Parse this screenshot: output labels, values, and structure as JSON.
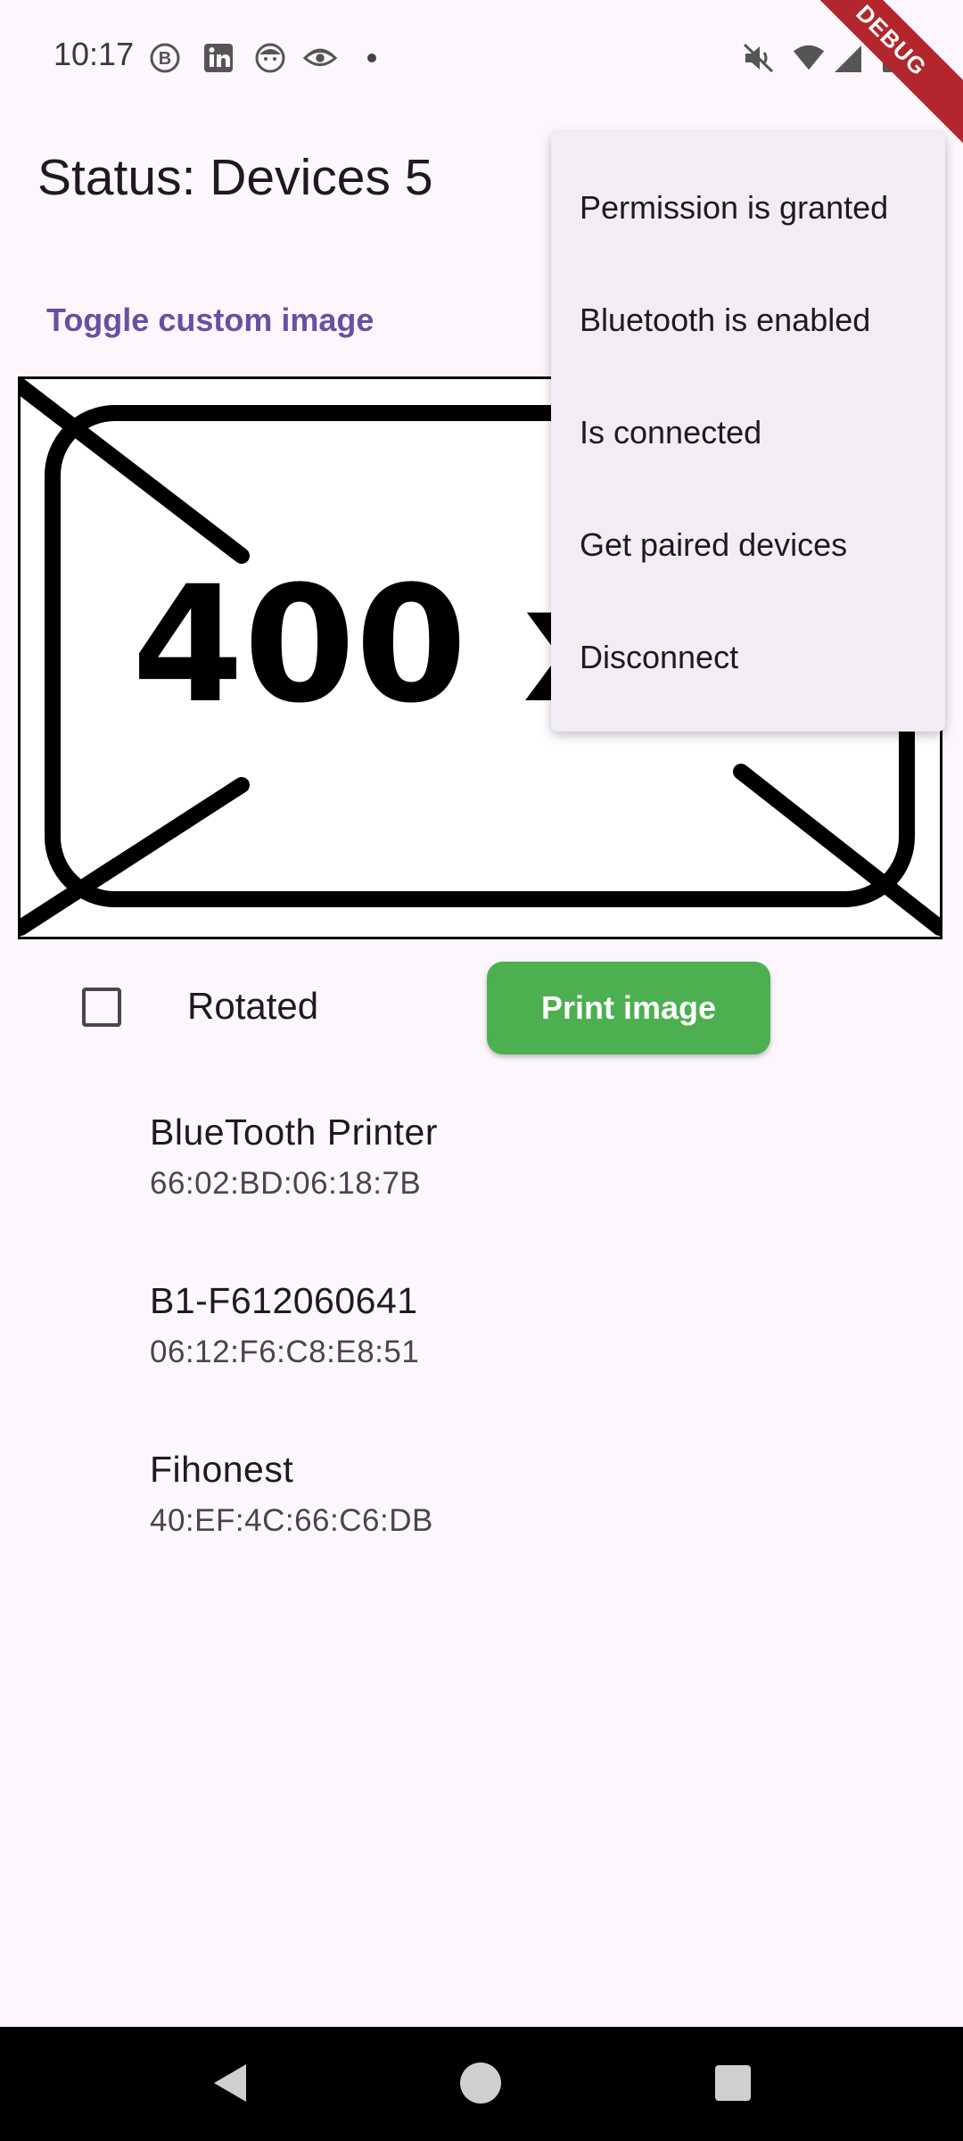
{
  "status_bar": {
    "time": "10:17",
    "left_icons": [
      "b-circle-icon",
      "linkedin-icon",
      "face-icon",
      "eye-icon"
    ],
    "right_icons": [
      "mute-icon",
      "wifi-icon",
      "signal-icon",
      "battery-icon"
    ]
  },
  "debug_banner": "DEBUG",
  "header": {
    "title": "Status: Devices 5"
  },
  "toggle_custom_image_label": "Toggle custom image",
  "preview_image": {
    "text": "400 x"
  },
  "controls": {
    "rotated_label": "Rotated",
    "rotated_checked": false,
    "print_label": "Print image",
    "print_color": "#4caf50"
  },
  "devices": [
    {
      "name": "BlueTooth Printer",
      "address": "66:02:BD:06:18:7B"
    },
    {
      "name": "B1-F612060641",
      "address": "06:12:F6:C8:E8:51"
    },
    {
      "name": "Fihonest",
      "address": "40:EF:4C:66:C6:DB"
    }
  ],
  "menu": {
    "items": [
      {
        "label": "Permission is granted"
      },
      {
        "label": "Bluetooth is enabled"
      },
      {
        "label": "Is connected"
      },
      {
        "label": "Get paired devices"
      },
      {
        "label": "Disconnect"
      }
    ]
  },
  "colors": {
    "accent": "#6750a4",
    "background": "#fdf7fd",
    "debug": "#b3262d"
  }
}
